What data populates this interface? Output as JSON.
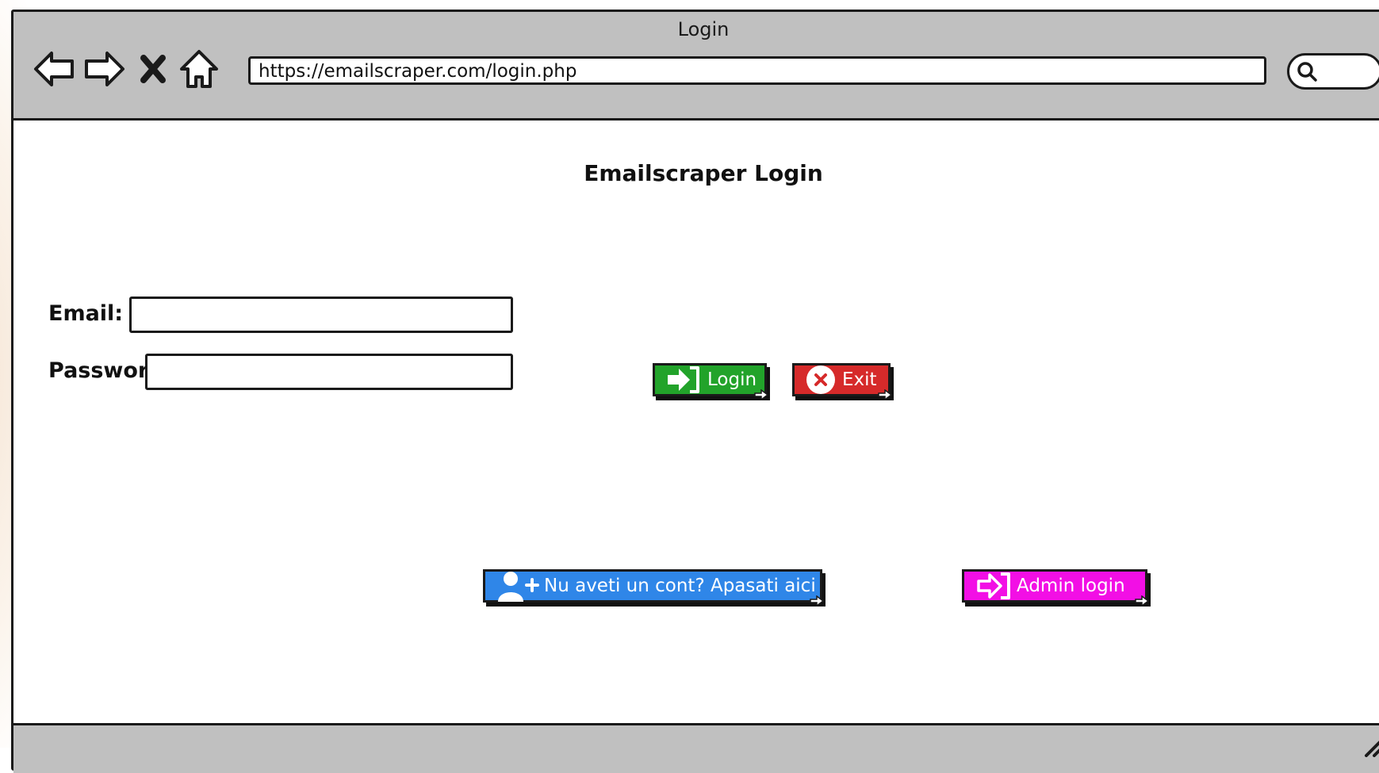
{
  "window": {
    "title": "Login",
    "url": "https://emailscraper.com/login.php"
  },
  "nav": {
    "back_icon": "arrow-left-icon",
    "forward_icon": "arrow-right-icon",
    "stop_icon": "close-icon",
    "home_icon": "home-icon",
    "search_icon": "search-icon"
  },
  "page": {
    "heading": "Emailscraper Login"
  },
  "form": {
    "email_label": "Email:",
    "email_value": "",
    "password_label": "Password:",
    "password_value": ""
  },
  "actions": {
    "login_label": "Login",
    "exit_label": "Exit",
    "register_label": "Nu aveti un cont? Apasati aici",
    "admin_label": "Admin login"
  },
  "colors": {
    "chrome": "#c0c0c0",
    "login": "#22a32a",
    "exit": "#d62a2a",
    "register": "#2f86e8",
    "admin": "#f20fe5"
  }
}
